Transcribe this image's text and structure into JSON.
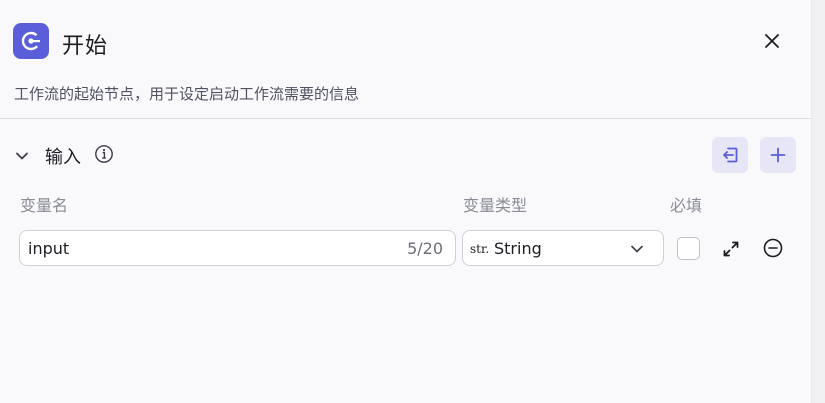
{
  "header": {
    "title": "开始",
    "description": "工作流的起始节点，用于设定启动工作流需要的信息",
    "node_icon": "start-node-icon",
    "close_icon": "close-icon"
  },
  "input_section": {
    "title": "输入",
    "info_icon": "info-icon",
    "import_icon": "import-icon",
    "add_icon": "plus-icon",
    "columns": {
      "name": "变量名",
      "type": "变量类型",
      "required": "必填"
    },
    "rows": [
      {
        "name_value": "input",
        "char_count": "5/20",
        "type_prefix": "str.",
        "type_value": "String",
        "required": false
      }
    ]
  },
  "colors": {
    "accent": "#5a5fd9",
    "accent_soft": "#e6e6f7"
  }
}
